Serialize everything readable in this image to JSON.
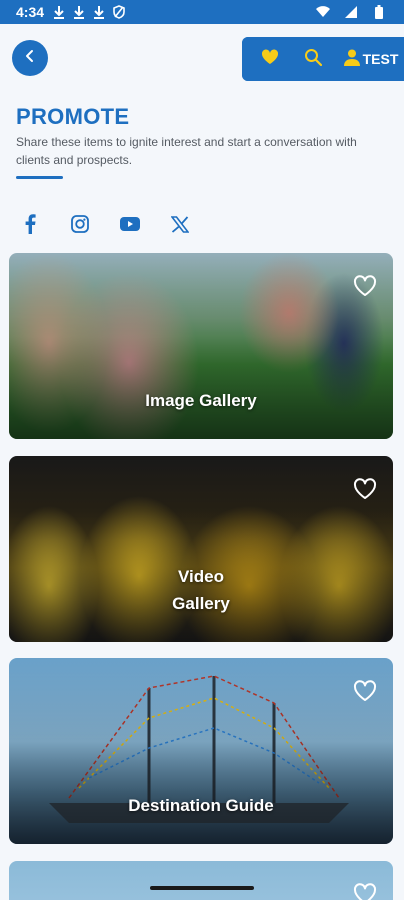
{
  "status_bar": {
    "time": "4:34"
  },
  "toolbar": {
    "account_label": "TEST"
  },
  "page": {
    "title": "PROMOTE",
    "description": "Share these items to ignite interest and start a conversation with clients and prospects."
  },
  "socials": [
    {
      "icon": "facebook-icon"
    },
    {
      "icon": "instagram-icon"
    },
    {
      "icon": "youtube-icon"
    },
    {
      "icon": "x-icon"
    }
  ],
  "cards": [
    {
      "label": "Image Gallery"
    },
    {
      "label_line1": "Video",
      "label_line2": "Gallery"
    },
    {
      "label": "Destination Guide"
    },
    {
      "label": ""
    }
  ],
  "colors": {
    "brand": "#1e6fc0",
    "accent": "#f7cc18"
  }
}
